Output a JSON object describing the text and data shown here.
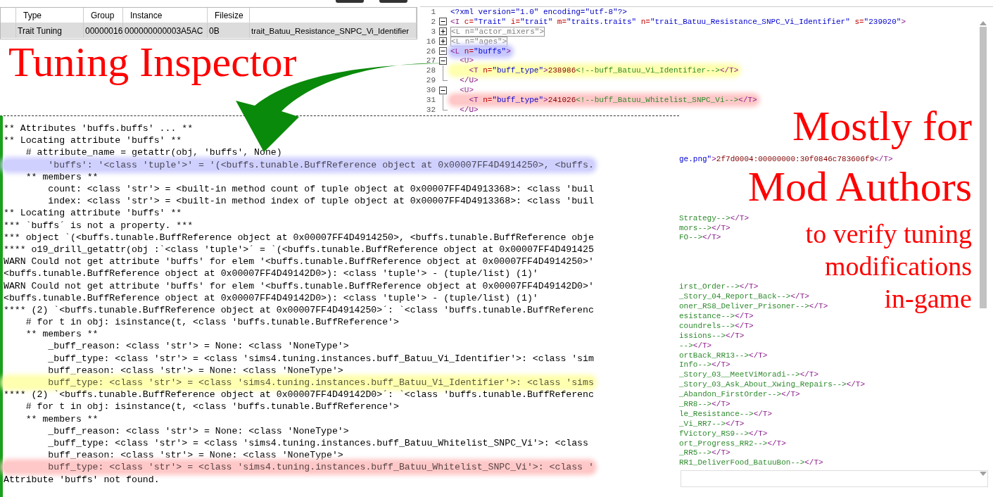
{
  "table": {
    "columns": [
      "Type",
      "Group",
      "Instance",
      "Filesize",
      ""
    ],
    "rows": [
      {
        "selected": true,
        "cells": [
          "Trait Tuning",
          "00000016",
          "000000000003A5AC",
          "0B",
          "trait_Batuu_Resistance_SNPC_Vi_Identifier"
        ]
      }
    ]
  },
  "xml_lines": [
    {
      "num": "1",
      "kind": "none",
      "segments": [
        {
          "kind": "pi",
          "text": "<?xml version=\"1.0\" encoding=\"utf-8\"?>"
        }
      ]
    },
    {
      "num": "2",
      "kind": "minus",
      "segments": [
        {
          "kind": "tag",
          "text": "<I"
        },
        {
          "kind": "attr",
          "text": " c="
        },
        {
          "kind": "value",
          "text": "\"Trait\""
        },
        {
          "kind": "attr",
          "text": " i="
        },
        {
          "kind": "value",
          "text": "\"trait\""
        },
        {
          "kind": "attr",
          "text": " m="
        },
        {
          "kind": "value",
          "text": "\"traits.traits\""
        },
        {
          "kind": "attr",
          "text": " n="
        },
        {
          "kind": "value",
          "text": "\"trait_Batuu_Resistance_SNPC_Vi_Identifier\""
        },
        {
          "kind": "attr",
          "text": " s="
        },
        {
          "kind": "value",
          "text": "\"239020\""
        },
        {
          "kind": "tag",
          "text": ">"
        }
      ]
    },
    {
      "num": "3",
      "kind": "plus",
      "segments": [
        {
          "kind": "folded",
          "text": "<L n=\"actor_mixers\">"
        }
      ]
    },
    {
      "num": "16",
      "kind": "plus",
      "segments": [
        {
          "kind": "folded",
          "text": "<L n=\"ages\">"
        }
      ]
    },
    {
      "num": "26",
      "kind": "minus",
      "color": "#c8c8ff",
      "segments": [
        {
          "kind": "tag",
          "text": "<L"
        },
        {
          "kind": "attr",
          "text": " n="
        },
        {
          "kind": "value",
          "text": "\"buffs\""
        },
        {
          "kind": "tag",
          "text": ">"
        }
      ]
    },
    {
      "num": "27",
      "kind": "minus",
      "segments": [
        {
          "kind": "tag",
          "text": "  <U>"
        }
      ]
    },
    {
      "num": "28",
      "kind": "branch",
      "color": "#ffffb0",
      "segments": [
        {
          "kind": "tag",
          "text": "    <T"
        },
        {
          "kind": "attr",
          "text": " n="
        },
        {
          "kind": "value",
          "text": "\"buff_type\""
        },
        {
          "kind": "tag",
          "text": ">"
        },
        {
          "kind": "num",
          "text": "238986"
        },
        {
          "kind": "comment",
          "text": "<!--buff_Batuu_Vi_Identifier-->"
        },
        {
          "kind": "tag",
          "text": "</T>"
        }
      ]
    },
    {
      "num": "29",
      "kind": "end",
      "segments": [
        {
          "kind": "tag",
          "text": "  </U>"
        }
      ]
    },
    {
      "num": "30",
      "kind": "minus",
      "segments": [
        {
          "kind": "tag",
          "text": "  <U>"
        }
      ]
    },
    {
      "num": "31",
      "kind": "branch",
      "color": "#ffc8c8",
      "segments": [
        {
          "kind": "tag",
          "text": "    <T"
        },
        {
          "kind": "attr",
          "text": " n="
        },
        {
          "kind": "value",
          "text": "\"buff_type\""
        },
        {
          "kind": "tag",
          "text": ">"
        },
        {
          "kind": "num",
          "text": "241026"
        },
        {
          "kind": "comment",
          "text": "<!--buff_Batuu_Whitelist_SNPC_Vi-->"
        },
        {
          "kind": "tag",
          "text": "</T>"
        }
      ]
    },
    {
      "num": "32",
      "kind": "end",
      "segments": [
        {
          "kind": "tag",
          "text": "  </U>"
        }
      ]
    }
  ],
  "xml_fragments": [
    [
      {
        "segments": [
          {
            "kind": "value",
            "text": "ge.png\""
          },
          {
            "kind": "tag",
            "text": ">"
          },
          {
            "kind": "num",
            "text": "2f7d0004:00000000:30f0846c783606f9"
          },
          {
            "kind": "tag",
            "text": "</T>"
          }
        ]
      }
    ],
    [
      {
        "segments": [
          {
            "kind": "comment",
            "text": "Strategy-->"
          },
          {
            "kind": "tag",
            "text": "</T>"
          }
        ]
      },
      {
        "segments": [
          {
            "kind": "comment",
            "text": "mors-->"
          },
          {
            "kind": "tag",
            "text": "</T>"
          }
        ]
      },
      {
        "segments": [
          {
            "kind": "comment",
            "text": "FO-->"
          },
          {
            "kind": "tag",
            "text": "</T>"
          }
        ]
      }
    ],
    [
      {
        "segments": [
          {
            "kind": "comment",
            "text": "irst_Order-->"
          },
          {
            "kind": "tag",
            "text": "</T>"
          }
        ]
      },
      {
        "segments": [
          {
            "kind": "comment",
            "text": "_Story_04_Report_Back-->"
          },
          {
            "kind": "tag",
            "text": "</T>"
          }
        ]
      },
      {
        "segments": [
          {
            "kind": "comment",
            "text": "oner_RS8_Deliver_Prisoner-->"
          },
          {
            "kind": "tag",
            "text": "</T>"
          }
        ]
      },
      {
        "segments": [
          {
            "kind": "comment",
            "text": "esistance-->"
          },
          {
            "kind": "tag",
            "text": "</T>"
          }
        ]
      },
      {
        "segments": [
          {
            "kind": "comment",
            "text": "coundrels-->"
          },
          {
            "kind": "tag",
            "text": "</T>"
          }
        ]
      },
      {
        "segments": [
          {
            "kind": "comment",
            "text": "issions-->"
          },
          {
            "kind": "tag",
            "text": "</T>"
          }
        ]
      },
      {
        "segments": [
          {
            "kind": "comment",
            "text": "-->"
          },
          {
            "kind": "tag",
            "text": "</T>"
          }
        ]
      },
      {
        "segments": [
          {
            "kind": "comment",
            "text": "ortBack_RR13-->"
          },
          {
            "kind": "tag",
            "text": "</T>"
          }
        ]
      },
      {
        "segments": [
          {
            "kind": "comment",
            "text": "Info-->"
          },
          {
            "kind": "tag",
            "text": "</T>"
          }
        ]
      },
      {
        "segments": [
          {
            "kind": "comment",
            "text": "_Story_03__MeetViMoradi-->"
          },
          {
            "kind": "tag",
            "text": "</T>"
          }
        ]
      },
      {
        "segments": [
          {
            "kind": "comment",
            "text": "_Story_03_Ask_About_Xwing_Repairs-->"
          },
          {
            "kind": "tag",
            "text": "</T>"
          }
        ]
      },
      {
        "segments": [
          {
            "kind": "comment",
            "text": "_Abandon_FirstOrder-->"
          },
          {
            "kind": "tag",
            "text": "</T>"
          }
        ]
      },
      {
        "segments": [
          {
            "kind": "comment",
            "text": "_RR8-->"
          },
          {
            "kind": "tag",
            "text": "</T>"
          }
        ]
      },
      {
        "segments": [
          {
            "kind": "comment",
            "text": "le_Resistance-->"
          },
          {
            "kind": "tag",
            "text": "</T>"
          }
        ]
      },
      {
        "segments": [
          {
            "kind": "comment",
            "text": "_Vi_RR7-->"
          },
          {
            "kind": "tag",
            "text": "</T>"
          }
        ]
      },
      {
        "segments": [
          {
            "kind": "comment",
            "text": "fVictory_RS9-->"
          },
          {
            "kind": "tag",
            "text": "</T>"
          }
        ]
      },
      {
        "segments": [
          {
            "kind": "comment",
            "text": "ort_Progress_RR2-->"
          },
          {
            "kind": "tag",
            "text": "</T>"
          }
        ]
      },
      {
        "segments": [
          {
            "kind": "comment",
            "text": "_RR5-->"
          },
          {
            "kind": "tag",
            "text": "</T>"
          }
        ]
      },
      {
        "segments": [
          {
            "kind": "comment",
            "text": "RR1_DeliverFood_BatuuBon-->"
          },
          {
            "kind": "tag",
            "text": "</T>"
          }
        ]
      }
    ]
  ],
  "log_lines": [
    {
      "text": "** Attributes 'buffs.buffs' ... **"
    },
    {
      "text": "** Locating attribute 'buffs' **"
    },
    {
      "text": "    # attribute_name = getattr(obj, 'buffs', None)"
    },
    {
      "text": "        'buffs': '<class 'tuple'>' = '(<buffs.tunable.BuffReference object at 0x00007FF4D4914250>, <buffs.",
      "color": "#d0d0ff"
    },
    {
      "text": "    ** members **"
    },
    {
      "text": "        count: <class 'str'> = <built-in method count of tuple object at 0x00007FF4D4913368>: <class 'buil"
    },
    {
      "text": "        index: <class 'str'> = <built-in method index of tuple object at 0x00007FF4D4913368>: <class 'buil"
    },
    {
      "text": "** Locating attribute 'buffs' **"
    },
    {
      "text": "*** `buffs´ is not a property. ***"
    },
    {
      "text": "*** object `(<buffs.tunable.BuffReference object at 0x00007FF4D4914250>, <buffs.tunable.BuffReference obje"
    },
    {
      "text": "**** o19_drill_getattr(obj :`<class 'tuple'>´ = `(<buffs.tunable.BuffReference object at 0x00007FF4D491425"
    },
    {
      "text": "WARN Could not get attribute 'buffs' for elem '<buffs.tunable.BuffReference object at 0x00007FF4D4914250>'"
    },
    {
      "text": "<buffs.tunable.BuffReference object at 0x00007FF4D49142D0>): <class 'tuple'> - (tuple/list) (1)'"
    },
    {
      "text": "WARN Could not get attribute 'buffs' for elem '<buffs.tunable.BuffReference object at 0x00007FF4D49142D0>'"
    },
    {
      "text": "<buffs.tunable.BuffReference object at 0x00007FF4D49142D0>): <class 'tuple'> - (tuple/list) (1)'"
    },
    {
      "text": "**** (2) `<buffs.tunable.BuffReference object at 0x00007FF4D4914250>´: `<class 'buffs.tunable.BuffReferenc"
    },
    {
      "text": "    # for t in obj: isinstance(t, <class 'buffs.tunable.BuffReference'>"
    },
    {
      "text": "    ** members **"
    },
    {
      "text": "        _buff_reason: <class 'str'> = None: <class 'NoneType'>"
    },
    {
      "text": "        _buff_type: <class 'str'> = <class 'sims4.tuning.instances.buff_Batuu_Vi_Identifier'>: <class 'sim"
    },
    {
      "text": "        buff_reason: <class 'str'> = None: <class 'NoneType'>"
    },
    {
      "text": "        buff_type: <class 'str'> = <class 'sims4.tuning.instances.buff_Batuu_Vi_Identifier'>: <class 'sims",
      "color": "#ffffb0"
    },
    {
      "text": "**** (2) `<buffs.tunable.BuffReference object at 0x00007FF4D49142D0>´: `<class 'buffs.tunable.BuffReferenc"
    },
    {
      "text": "    # for t in obj: isinstance(t, <class 'buffs.tunable.BuffReference'>"
    },
    {
      "text": "    ** members **"
    },
    {
      "text": "        _buff_reason: <class 'str'> = None: <class 'NoneType'>"
    },
    {
      "text": "        _buff_type: <class 'str'> = <class 'sims4.tuning.instances.buff_Batuu_Whitelist_SNPC_Vi'>: <class"
    },
    {
      "text": "        buff_reason: <class 'str'> = None: <class 'NoneType'>"
    },
    {
      "text": "        buff_type: <class 'str'> = <class 'sims4.tuning.instances.buff_Batuu_Whitelist_SNPC_Vi'>: <class '",
      "color": "#ffc8c8"
    },
    {
      "text": "Attribute 'buffs' not found."
    }
  ],
  "annotations": {
    "title": "Tuning Inspector",
    "subtitle_lines": [
      "Mostly for",
      "Mod Authors"
    ],
    "note_lines": [
      "to verify tuning",
      "modifications",
      "in-game"
    ]
  }
}
